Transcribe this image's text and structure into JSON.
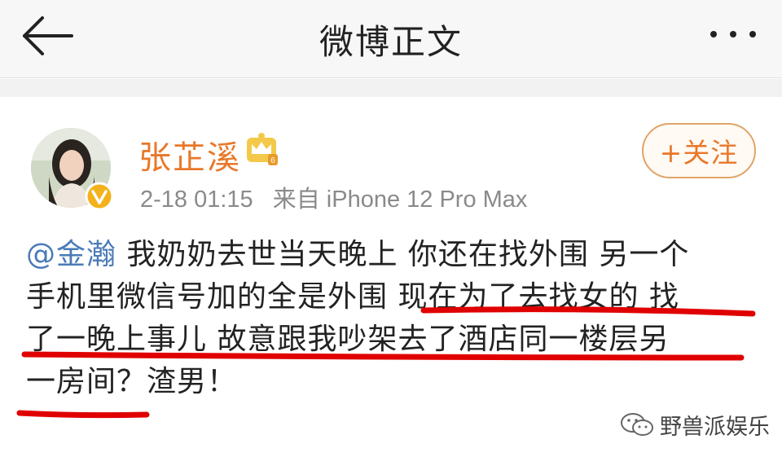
{
  "header": {
    "title": "微博正文"
  },
  "post": {
    "author": "张芷溪",
    "timestamp": "2-18 01:15",
    "source": "来自 iPhone 12 Pro Max",
    "follow_label": "+关注",
    "mention": "@金瀚",
    "lines": [
      "我奶奶去世当天晚上 你还在找外围 另一个",
      "手机里微信号加的全是外围 现在为了去找女的 找",
      "了一晚上事儿 故意跟我吵架去了酒店同一楼层另",
      "一房间？渣男！"
    ]
  },
  "watermark": {
    "text": "野兽派娱乐"
  },
  "colors": {
    "accent": "#e8782a",
    "mention": "#4a7bb7",
    "underline": "#e00000",
    "verify": "#f3b21b"
  },
  "icons": {
    "back": "arrow-left-icon",
    "more": "more-dots-icon",
    "crown": "crown-badge-icon",
    "verify": "verified-badge-icon",
    "watermark": "wechat-icon"
  }
}
